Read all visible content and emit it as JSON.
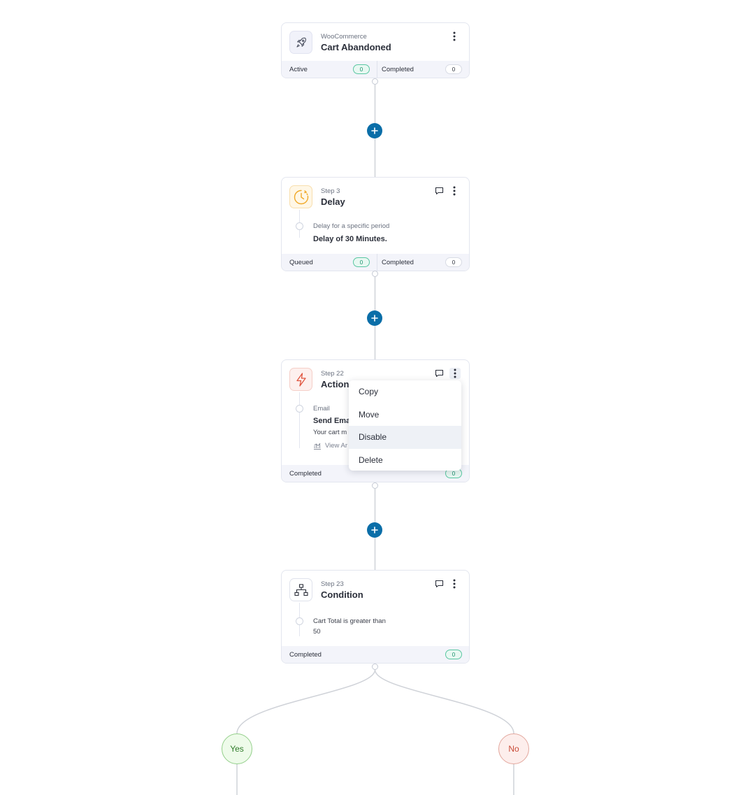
{
  "trigger": {
    "source": "WooCommerce",
    "title": "Cart Abandoned",
    "footer": {
      "left_label": "Active",
      "left_count": "0",
      "right_label": "Completed",
      "right_count": "0"
    }
  },
  "delay_step": {
    "step": "Step 3",
    "title": "Delay",
    "detail_label": "Delay for a specific period",
    "detail_value": "Delay of 30 Minutes.",
    "footer": {
      "left_label": "Queued",
      "left_count": "0",
      "right_label": "Completed",
      "right_count": "0"
    }
  },
  "action_step": {
    "step": "Step 22",
    "title": "Action",
    "detail_label": "Email",
    "detail_value": "Send Ema",
    "detail_text": "Your cart m",
    "analytics_label": "View Ar",
    "footer": {
      "label": "Completed",
      "count": "0"
    }
  },
  "context_menu": {
    "items": [
      "Copy",
      "Move",
      "Disable",
      "Delete"
    ],
    "highlighted": "Disable"
  },
  "condition_step": {
    "step": "Step 23",
    "title": "Condition",
    "detail_line1": "Cart Total is greater than",
    "detail_line2": "50",
    "footer": {
      "label": "Completed",
      "count": "0"
    }
  },
  "branches": {
    "yes": "Yes",
    "no": "No"
  },
  "colors": {
    "accent": "#0a6ea8",
    "success": "#16916a",
    "yes": "#2e7b29",
    "no": "#c94b37"
  },
  "icons": {
    "trigger": "rocket-icon",
    "delay": "clock-icon",
    "action": "lightning-icon",
    "condition": "hierarchy-icon",
    "add": "plus-icon",
    "menu": "kebab-icon",
    "note": "comment-icon",
    "analytics": "chart-icon"
  }
}
